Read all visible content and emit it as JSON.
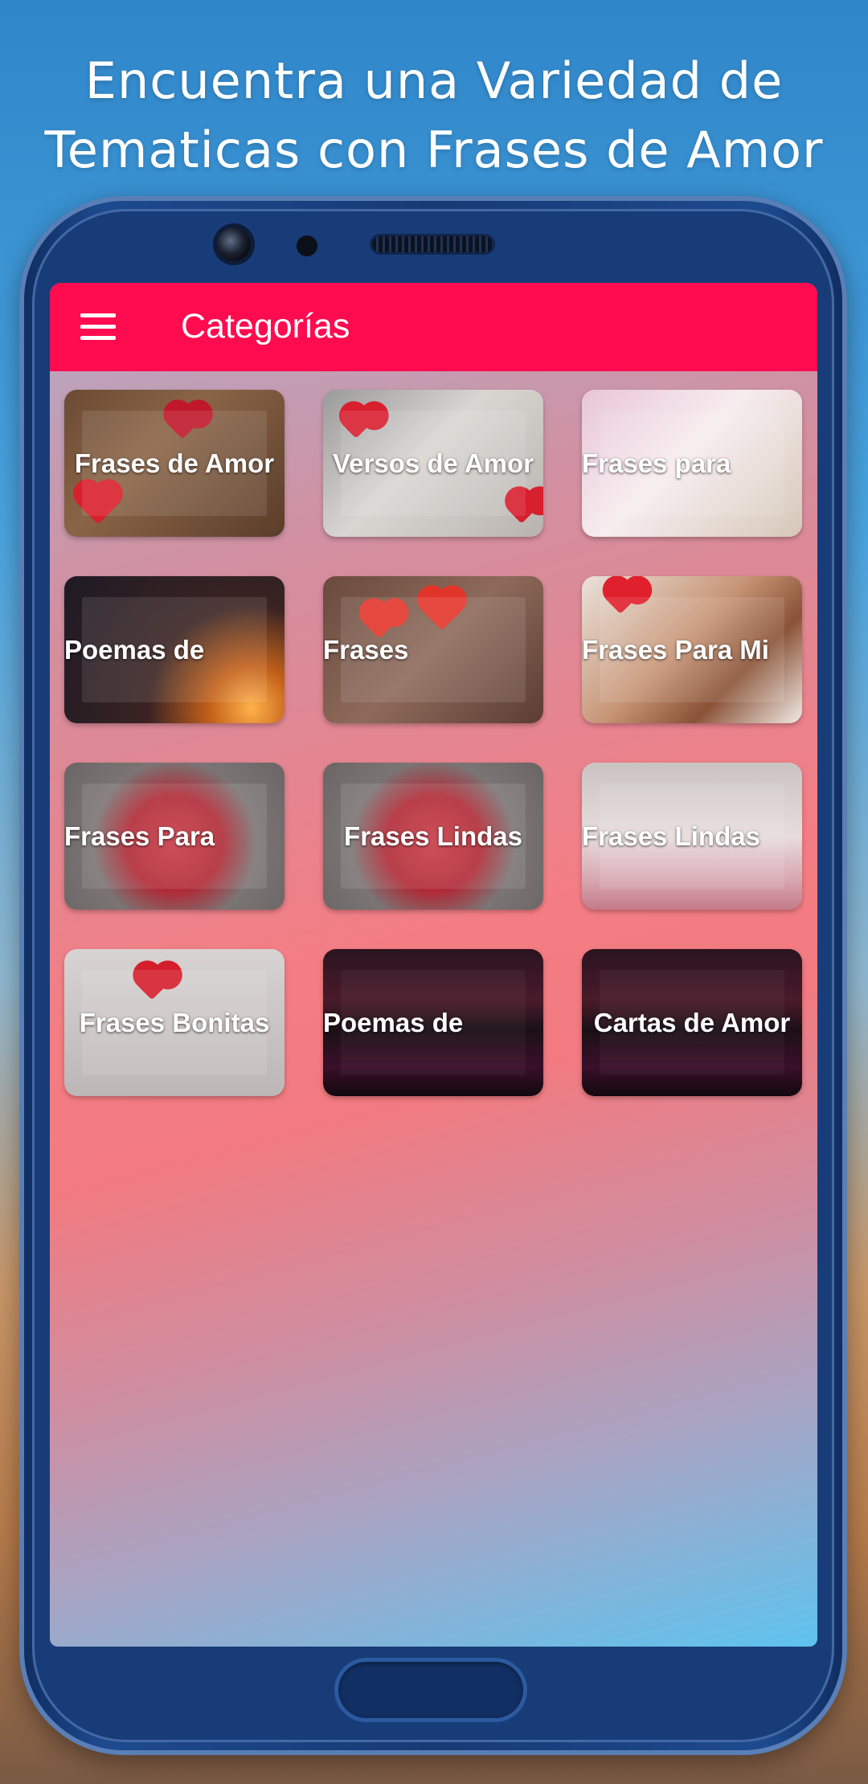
{
  "promo": {
    "line1": "Encuentra una Variedad de",
    "line2": "Tematicas con Frases de Amor"
  },
  "appbar": {
    "title": "Categorías",
    "menu_icon": "hamburger-menu-icon"
  },
  "colors": {
    "appbar": "#ff0b50",
    "phone_frame": "#183c78",
    "text": "#ffffff"
  },
  "categories": [
    {
      "label": "Frases de Amor",
      "align": "center"
    },
    {
      "label": "Versos de Amor",
      "align": "center"
    },
    {
      "label": "Frases para",
      "align": "left"
    },
    {
      "label": "Poemas de",
      "align": "left"
    },
    {
      "label": "Frases",
      "align": "left"
    },
    {
      "label": "Frases Para Mi",
      "align": "left"
    },
    {
      "label": "Frases Para",
      "align": "left"
    },
    {
      "label": "Frases Lindas",
      "align": "center"
    },
    {
      "label": "Frases Lindas",
      "align": "left"
    },
    {
      "label": "Frases Bonitas",
      "align": "center"
    },
    {
      "label": "Poemas de",
      "align": "left"
    },
    {
      "label": "Cartas de Amor",
      "align": "center"
    }
  ]
}
